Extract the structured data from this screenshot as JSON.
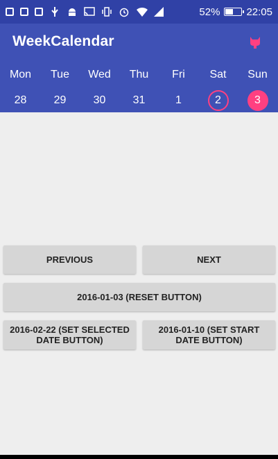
{
  "status_bar": {
    "battery_percent": "52%",
    "battery_level": 0.52,
    "time": "22:05",
    "icons": [
      "message-icon",
      "code-icon",
      "code-icon",
      "usb-icon",
      "android-icon",
      "cast-icon",
      "vibrate-icon",
      "alarm-icon",
      "wifi-icon",
      "signal-icon",
      "battery-icon"
    ]
  },
  "app_bar": {
    "title": "WeekCalendar",
    "action_icon": "github-icon"
  },
  "week": {
    "days": [
      {
        "name": "Mon",
        "date": "28",
        "state": "normal"
      },
      {
        "name": "Tue",
        "date": "29",
        "state": "normal"
      },
      {
        "name": "Wed",
        "date": "30",
        "state": "normal"
      },
      {
        "name": "Thu",
        "date": "31",
        "state": "normal"
      },
      {
        "name": "Fri",
        "date": "1",
        "state": "normal"
      },
      {
        "name": "Sat",
        "date": "2",
        "state": "start"
      },
      {
        "name": "Sun",
        "date": "3",
        "state": "selected"
      }
    ]
  },
  "buttons": {
    "previous": "PREVIOUS",
    "next": "NEXT",
    "reset": "2016-01-03 (RESET BUTTON)",
    "set_selected": "2016-02-22 (SET SELECTED DATE BUTTON)",
    "set_start": "2016-01-10 (SET START DATE BUTTON)"
  },
  "colors": {
    "primary": "#3f51b5",
    "primary_dark": "#3041a6",
    "accent": "#ff4081",
    "background": "#eeeeee",
    "button": "#d6d6d6"
  }
}
